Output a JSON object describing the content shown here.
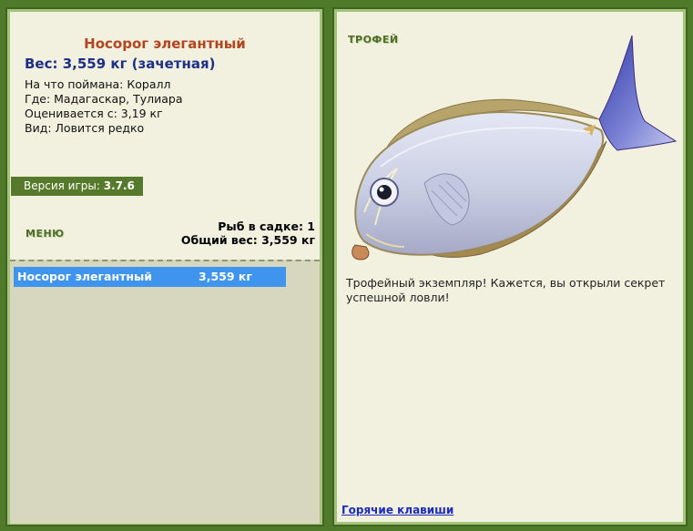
{
  "fish": {
    "name": "Носорог элегантный",
    "weight_line": "Вес: 3,559 кг (зачетная)",
    "details": [
      "На что поймана: Коралл",
      "Где: Мадагаскар, Тулиара",
      "Оценивается с: 3,19 кг",
      "Вид: Ловится редко"
    ]
  },
  "version": {
    "label": "Версия игры: ",
    "value": "3.7.6"
  },
  "menu_label": "МЕНЮ",
  "stats": {
    "cage": "Рыб в садке: 1",
    "total": "Общий вес: 3,559 кг"
  },
  "list": [
    {
      "name": "Носорог элегантный",
      "weight": "3,559 кг"
    }
  ],
  "trophy": {
    "label": "ТРОФЕЙ",
    "description": "Трофейный экземпляр! Кажется, вы открыли секрет успешной ловли!"
  },
  "hotkeys_label": "Горячие клавиши",
  "icons": {
    "fish_image": "surgeonfish-illustration"
  },
  "colors": {
    "background": "#4f7a2a",
    "panel": "#f2f1df",
    "title": "#b2441f",
    "weight": "#1d2f86",
    "selection": "#3f94ee"
  }
}
